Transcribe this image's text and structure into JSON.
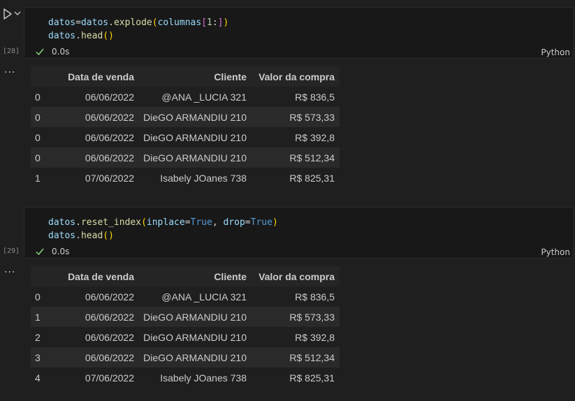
{
  "cells": [
    {
      "exec_count": "[28]",
      "code_lines": [
        {
          "var1": "datos",
          "eq": "=",
          "var2": "datos",
          "dot": ".",
          "fn": "explode",
          "open": "(",
          "arg": "columnas",
          "br_open": "[",
          "num": "1",
          "colon": ":",
          "br_close": "]",
          "close": ")"
        },
        {
          "var": "datos",
          "dot": ".",
          "fn": "head",
          "parens": "()"
        }
      ],
      "exec_time": "0.0s",
      "language": "Python"
    },
    {
      "exec_count": "[29]",
      "code_lines": [
        {
          "var": "datos",
          "dot": ".",
          "fn": "reset_index",
          "open": "(",
          "kw1": "inplace",
          "eq1": "=",
          "val1": "True",
          "comma": ", ",
          "kw2": "drop",
          "eq2": "=",
          "val2": "True",
          "close": ")"
        },
        {
          "var": "datos",
          "dot": ".",
          "fn": "head",
          "parens": "()"
        }
      ],
      "exec_time": "0.0s",
      "language": "Python"
    }
  ],
  "outputs": [
    {
      "columns": [
        "",
        "Data de venda",
        "Cliente",
        "Valor da compra"
      ],
      "rows": [
        [
          "0",
          "06/06/2022",
          "@ANA _LUCIA 321",
          "R$ 836,5"
        ],
        [
          "0",
          "06/06/2022",
          "DieGO ARMANDIU 210",
          "R$ 573,33"
        ],
        [
          "0",
          "06/06/2022",
          "DieGO ARMANDIU 210",
          "R$ 392,8"
        ],
        [
          "0",
          "06/06/2022",
          "DieGO ARMANDIU 210",
          "R$ 512,34"
        ],
        [
          "1",
          "07/06/2022",
          "Isabely JOanes 738",
          "R$ 825,31"
        ]
      ]
    },
    {
      "columns": [
        "",
        "Data de venda",
        "Cliente",
        "Valor da compra"
      ],
      "rows": [
        [
          "0",
          "06/06/2022",
          "@ANA _LUCIA 321",
          "R$ 836,5"
        ],
        [
          "1",
          "06/06/2022",
          "DieGO ARMANDIU 210",
          "R$ 573,33"
        ],
        [
          "2",
          "06/06/2022",
          "DieGO ARMANDIU 210",
          "R$ 392,8"
        ],
        [
          "3",
          "06/06/2022",
          "DieGO ARMANDIU 210",
          "R$ 512,34"
        ],
        [
          "4",
          "07/06/2022",
          "Isabely JOanes 738",
          "R$ 825,31"
        ]
      ]
    }
  ],
  "output_menu": "...",
  "icons": {
    "run": "play-icon",
    "run_menu": "chevron-down-icon",
    "status": "check-icon"
  },
  "colors": {
    "background": "#1f1f1f",
    "editor": "#181818",
    "check": "#89d185",
    "keyword": "#569cd6",
    "function": "#dcdcaa",
    "variable": "#9cdcfe"
  }
}
